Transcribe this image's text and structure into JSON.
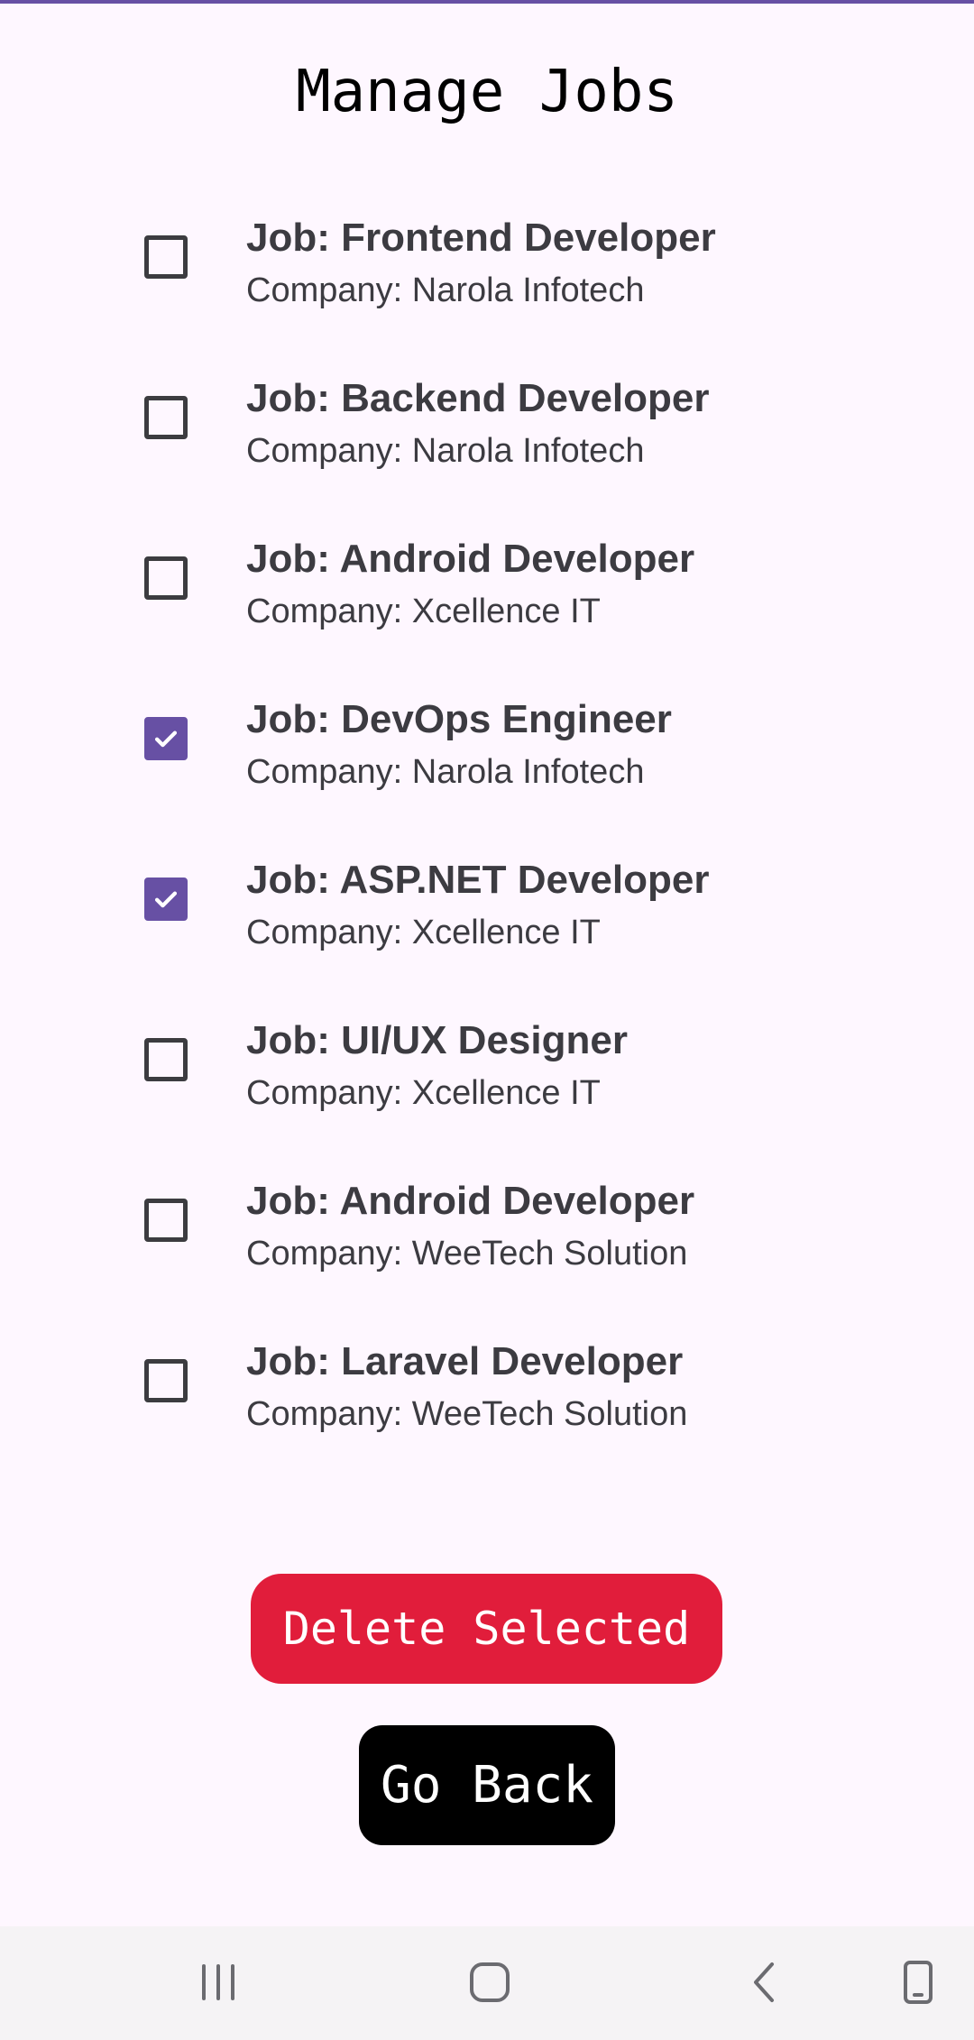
{
  "header": {
    "title": "Manage Jobs"
  },
  "jobs": [
    {
      "title": "Job: Frontend Developer",
      "company": "Company: Narola Infotech",
      "checked": false
    },
    {
      "title": "Job: Backend Developer",
      "company": "Company: Narola Infotech",
      "checked": false
    },
    {
      "title": "Job: Android Developer",
      "company": "Company: Xcellence IT",
      "checked": false
    },
    {
      "title": "Job: DevOps Engineer",
      "company": "Company: Narola Infotech",
      "checked": true
    },
    {
      "title": "Job: ASP.NET Developer",
      "company": "Company: Xcellence IT",
      "checked": true
    },
    {
      "title": "Job: UI/UX Designer",
      "company": "Company: Xcellence IT",
      "checked": false
    },
    {
      "title": "Job: Android Developer",
      "company": "Company: WeeTech Solution",
      "checked": false
    },
    {
      "title": "Job: Laravel Developer",
      "company": "Company: WeeTech Solution",
      "checked": false
    }
  ],
  "actions": {
    "delete_label": "Delete Selected",
    "back_label": "Go Back"
  },
  "colors": {
    "accent": "#6750a4",
    "delete": "#e11d3b",
    "back": "#000000",
    "background": "#fef7ff"
  },
  "nav_bar": {
    "icons": [
      "recent-apps-icon",
      "home-icon",
      "back-arrow-icon",
      "rotate-screen-icon"
    ]
  }
}
